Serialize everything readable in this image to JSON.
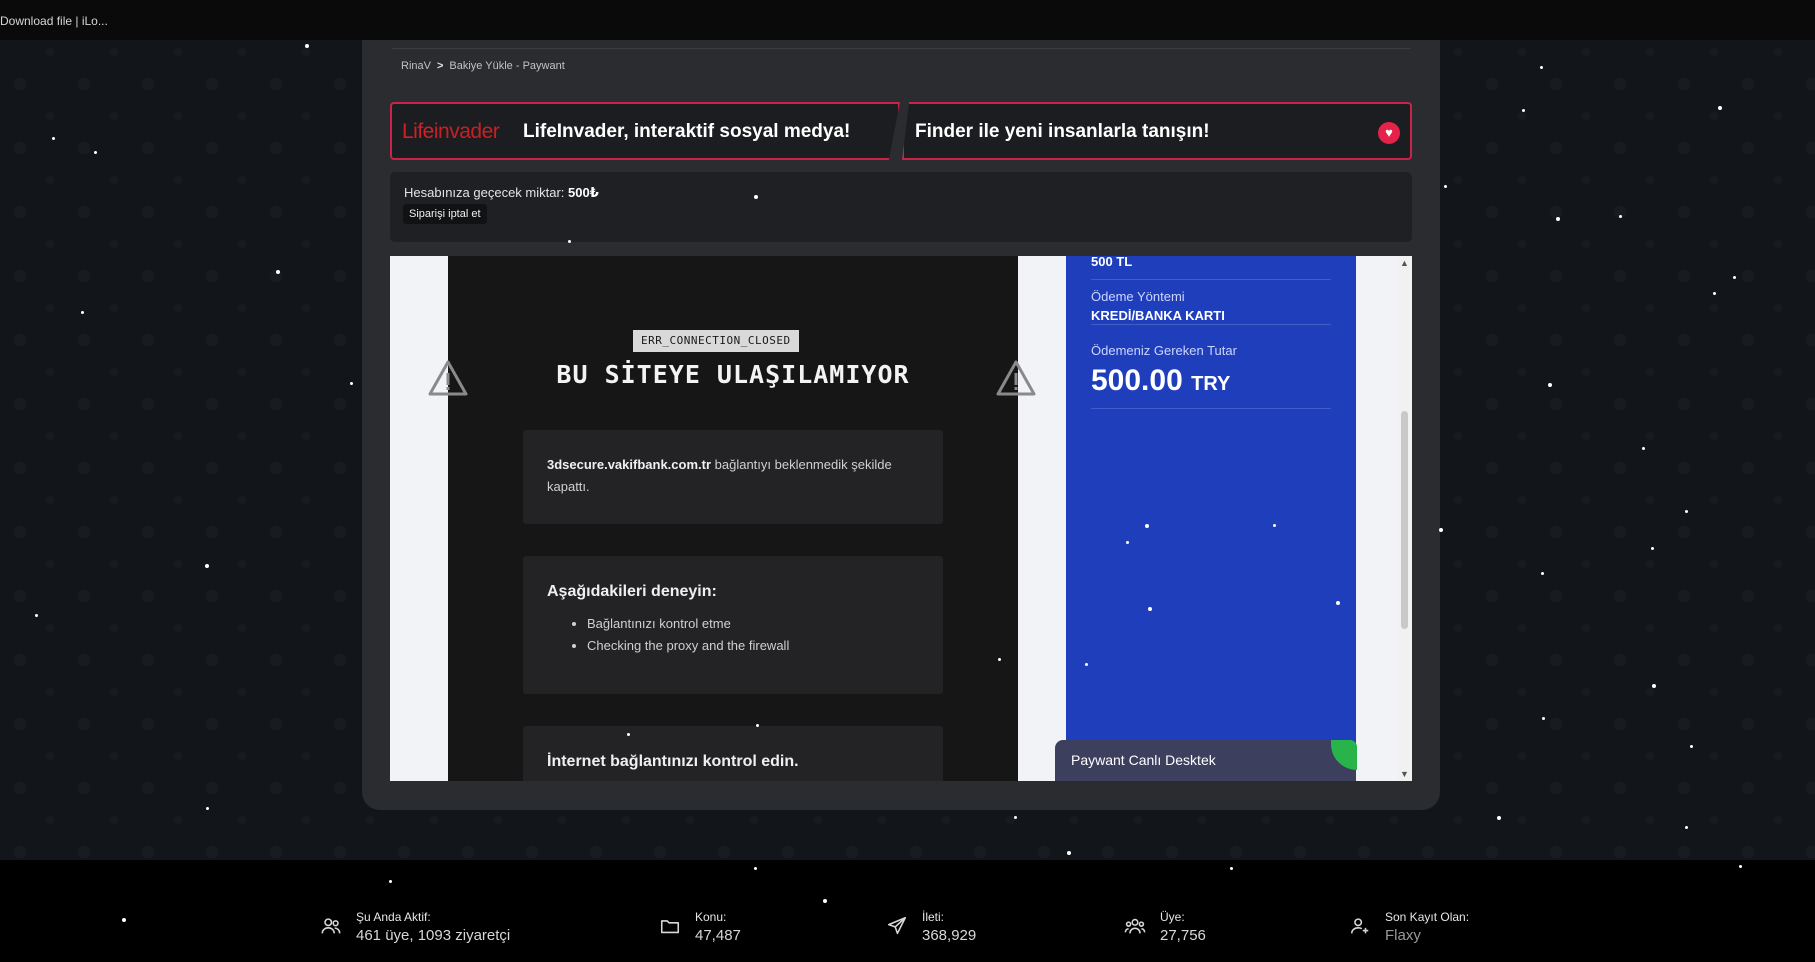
{
  "browser": {
    "tab_title": "Download file | iLo..."
  },
  "breadcrumb": {
    "home": "RinaV",
    "separator": ">",
    "current": "Bakiye Yükle - Paywant"
  },
  "banners": {
    "left_logo_bold": "Life",
    "left_logo_light": "invader",
    "left_text": "LifeInvader, interaktif sosyal medya!",
    "right_text": "Finder ile yeni insanlarla tanışın!",
    "right_icon": "heart-icon"
  },
  "order": {
    "amount_label": "Hesabınıza geçecek miktar:",
    "amount_value": "500₺",
    "cancel_label": "Siparişi iptal et"
  },
  "error_page": {
    "code": "ERR_CONNECTION_CLOSED",
    "title": "BU SİTEYE ULAŞILAMIYOR",
    "host": "3dsecure.vakifbank.com.tr",
    "message_rest": " bağlantıyı beklenmedik şekilde kapattı.",
    "try_heading": "Aşağıdakileri deneyin:",
    "suggestions": [
      "Bağlantınızı kontrol etme",
      "Checking the proxy and the firewall"
    ],
    "check_heading": "İnternet bağlantınızı kontrol edin."
  },
  "payment": {
    "partial_value": "500 TL",
    "method_label": "Ödeme Yöntemi",
    "method_value": "KREDİ/BANKA KARTI",
    "amount_label": "Ödemeniz Gereken Tutar",
    "amount_number": "500.00",
    "amount_currency": "TRY",
    "chat_label": "Paywant Canlı Desktek"
  },
  "footer": {
    "stats": [
      {
        "icon": "users-icon",
        "label": "Şu Anda Aktif:",
        "value": "461 üye, 1093 ziyaretçi"
      },
      {
        "icon": "folder-icon",
        "label": "Konu:",
        "value": "47,487"
      },
      {
        "icon": "send-icon",
        "label": "İleti:",
        "value": "368,929"
      },
      {
        "icon": "group-icon",
        "label": "Üye:",
        "value": "27,756"
      },
      {
        "icon": "user-plus-icon",
        "label": "Son Kayıt Olan:",
        "value": "Flaxy"
      }
    ]
  },
  "colors": {
    "accent_red": "#c8244a",
    "panel_bg": "#2b2c30",
    "payment_blue": "#1e3ebc",
    "chat_green": "#28b44a"
  }
}
